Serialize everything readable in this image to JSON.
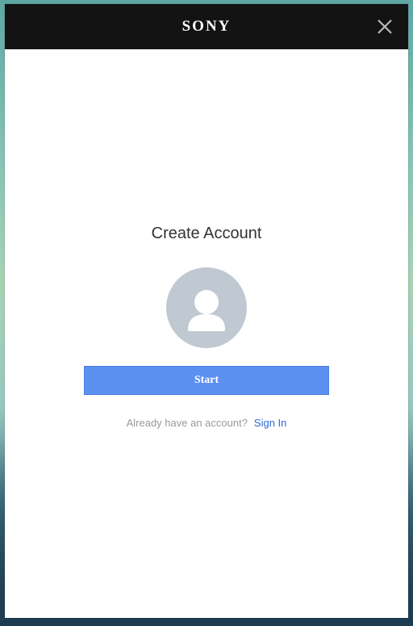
{
  "header": {
    "brand": "SONY",
    "close_icon": "close-icon"
  },
  "main": {
    "title": "Create Account",
    "avatar_icon": "user-avatar-icon",
    "start_label": "Start",
    "prompt_text": "Already have an account?",
    "signin_label": "Sign In"
  },
  "colors": {
    "header_bg": "#131313",
    "button_bg": "#5b8ff0",
    "link": "#2b6ad8",
    "avatar_bg": "#c0c9d2"
  }
}
